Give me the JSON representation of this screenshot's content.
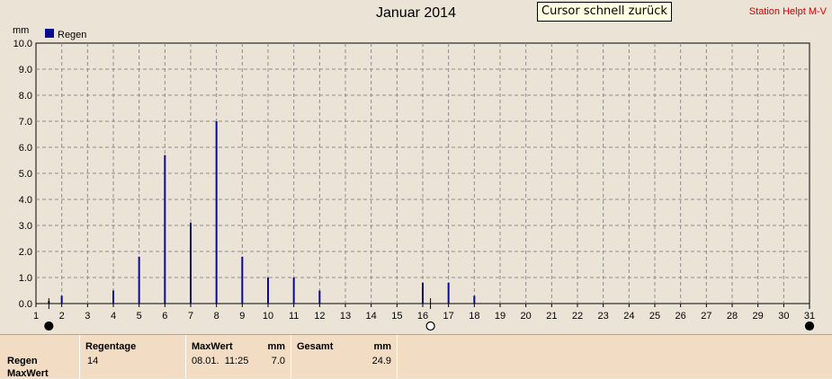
{
  "header": {
    "title": "Januar 2014",
    "station": "Station Helpt M-V",
    "tooltip": "Cursor schnell zurück"
  },
  "colors": {
    "background": "#ece3d7",
    "bar": "#0b0b8f",
    "station_text": "#d00000",
    "panel": "#f2dcc4",
    "grid": "#8c8c8c"
  },
  "chart_data": {
    "type": "bar",
    "title": "Januar 2014",
    "ylabel": "mm",
    "xlabel": "",
    "ylim": [
      0,
      10
    ],
    "y_ticks": [
      "0.0",
      "1.0",
      "2.0",
      "3.0",
      "4.0",
      "5.0",
      "6.0",
      "7.0",
      "8.0",
      "9.0",
      "10.0"
    ],
    "x_ticks": [
      1,
      2,
      3,
      4,
      5,
      6,
      7,
      8,
      9,
      10,
      11,
      12,
      13,
      14,
      15,
      16,
      17,
      18,
      19,
      20,
      21,
      22,
      23,
      24,
      25,
      26,
      27,
      28,
      29,
      30,
      31
    ],
    "grid": true,
    "legend": {
      "position": "top-left",
      "entries": [
        "Regen"
      ]
    },
    "series": [
      {
        "name": "Regen",
        "x": [
          1.5,
          2,
          4,
          5,
          6,
          7,
          8,
          9,
          10,
          11,
          12,
          16,
          17,
          18
        ],
        "values": [
          0.1,
          0.3,
          0.5,
          1.8,
          5.7,
          3.1,
          7.0,
          1.8,
          1.0,
          1.0,
          0.5,
          0.8,
          0.8,
          0.3
        ]
      }
    ],
    "cursors": [
      {
        "x": 1.5,
        "style": "filled"
      },
      {
        "x": 16.3,
        "style": "hollow"
      },
      {
        "x": 31,
        "style": "filled"
      }
    ]
  },
  "stats": {
    "row_labels": [
      "Regen",
      "MaxWert"
    ],
    "regentage": {
      "header": "Regentage",
      "value": "14"
    },
    "maxwert": {
      "header": "MaxWert",
      "unit": "mm",
      "date": "08.01.  11:25",
      "value": "7.0"
    },
    "gesamt": {
      "header": "Gesamt",
      "unit": "mm",
      "value": "24.9"
    }
  }
}
